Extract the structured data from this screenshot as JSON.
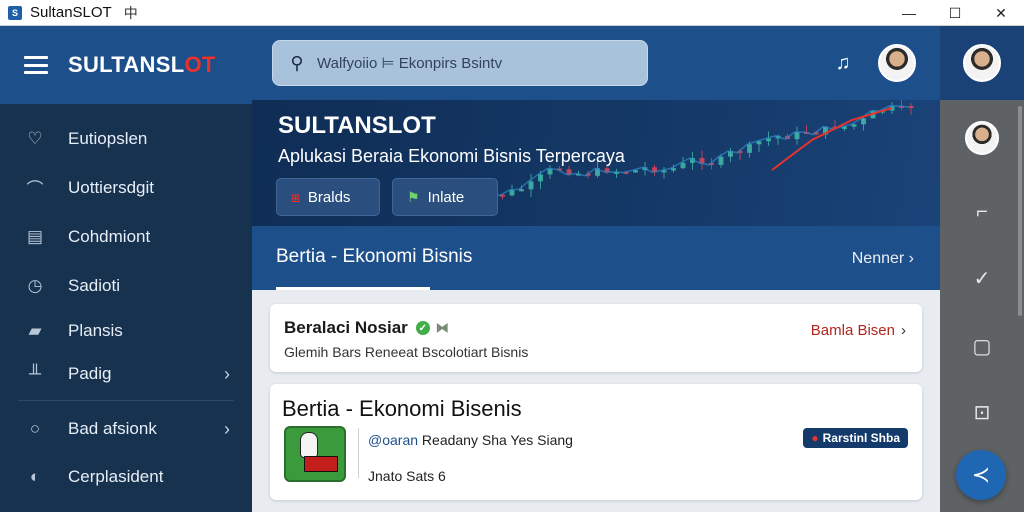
{
  "window": {
    "title": "SultanSLOT",
    "extra_glyph": "中",
    "controls": {
      "minimize": "—",
      "maximize": "☐",
      "close": "✕"
    }
  },
  "sidebar": {
    "brand_main": "SULTANSL",
    "brand_accent": "OT",
    "items": [
      {
        "label": "Eutiopslen",
        "icon": "heart-icon"
      },
      {
        "label": "Uottiersdgit",
        "icon": "chat-icon"
      },
      {
        "label": "Cohdmiont",
        "icon": "calendar-icon"
      },
      {
        "label": "Sadioti",
        "icon": "clock-icon"
      },
      {
        "label": "Plansis",
        "icon": "folder-icon"
      },
      {
        "label": "Padig",
        "icon": "chart-icon",
        "chevron": "›"
      },
      {
        "label": "Bad afsionk",
        "icon": "search-icon",
        "chevron": "›"
      },
      {
        "label": "Cerplasident",
        "icon": "globe-icon"
      }
    ]
  },
  "header": {
    "search_placeholder": "Walfyoiio ⊨ Ekonpirs Bsintv",
    "search_icon": "search-icon",
    "bell_icon": "bell-icon"
  },
  "hero": {
    "title": "SULTANSLOT",
    "subtitle": "Aplukasi Beraia Ekonomi Bisnis Terpercaya",
    "button1": "Bralds",
    "button2": "Inlate"
  },
  "tabs": {
    "active": "Bertia - Ekonomi Bisnis",
    "more": "Nenner ›"
  },
  "cards": [
    {
      "title": "Beralaci Nosiar",
      "subtitle": "Glemih Bars Reneeat Bscolotiart Bisnis",
      "link": "Bamla Bisen"
    },
    {
      "title": "Bertia - Ekonomi Bisenis",
      "source": "@oaran",
      "meta": "Readany Sha Yes Siang",
      "footer": "Jnato Sats 6",
      "badge": "Rarstinl Shba"
    }
  ],
  "rail": {
    "items": [
      "user-icon",
      "edit-icon",
      "check-icon",
      "square-icon",
      "image-icon"
    ],
    "fab_icon": "share-icon"
  },
  "colors": {
    "primary": "#1d4f8a",
    "sidebar": "#17324f",
    "accent_red": "#e8322c",
    "rail": "#5f6265"
  }
}
